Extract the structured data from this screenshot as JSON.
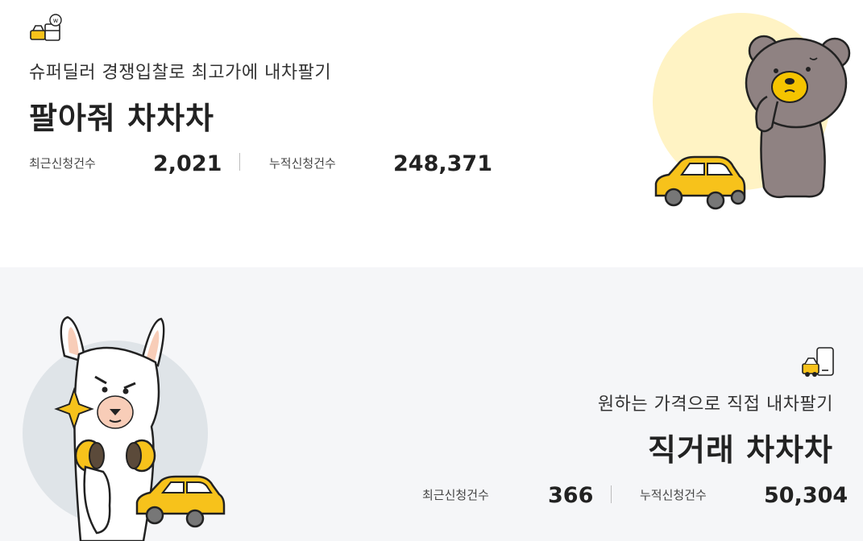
{
  "top_service": {
    "icon": "auction-car-icon",
    "subtitle": "슈퍼딜러 경쟁입찰로 최고가에 내차팔기",
    "title": "팔아줘 차차차",
    "recent_label": "최근신청건수",
    "recent_value": "2,021",
    "total_label": "누적신청건수",
    "total_value": "248,371",
    "illustration": "bear-with-yellow-car",
    "accent_color": "#fff3c4"
  },
  "bottom_service": {
    "icon": "direct-deal-phone-car-icon",
    "subtitle": "원하는 가격으로 직접 내차팔기",
    "title": "직거래 차차차",
    "recent_label": "최근신청건수",
    "recent_value": "366",
    "total_label": "누적신청건수",
    "total_value": "50,304",
    "illustration": "alpaca-with-yellow-car",
    "accent_color": "#dfe4e8"
  },
  "colors": {
    "car_yellow": "#f7c21b",
    "bottom_bg": "#f5f6f8"
  }
}
